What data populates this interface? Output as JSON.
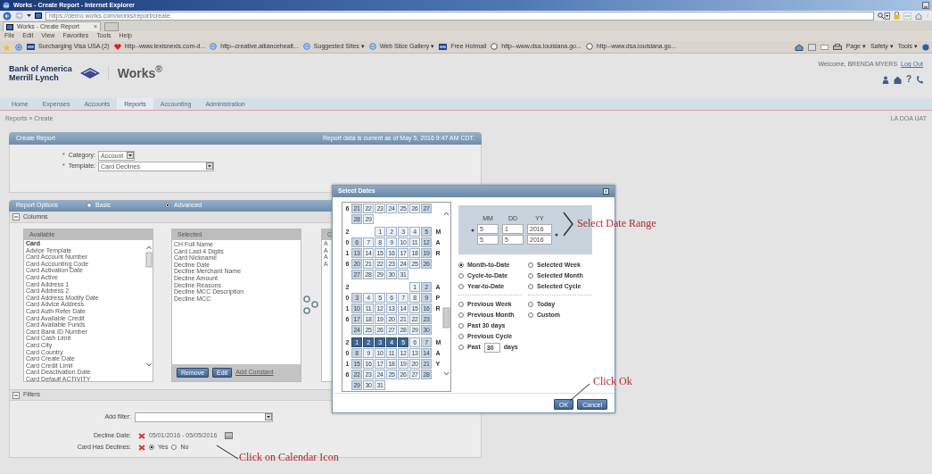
{
  "browser": {
    "title": "Works - Create Report - Internet Explorer",
    "address": "https://demo.works.com/works/report/create",
    "tab": "Works - Create Report",
    "tab_close": "×",
    "menu": [
      "File",
      "Edit",
      "View",
      "Favorites",
      "Tools",
      "Help"
    ],
    "favorites": [
      {
        "label": "Surcharging Visa USA (2)",
        "kind": "page"
      },
      {
        "label": "http--www.lexisnexis.com-d...",
        "kind": "heart"
      },
      {
        "label": "http--creative.alliancehealt...",
        "kind": "ie"
      },
      {
        "label": "Suggested Sites ▾",
        "kind": "ie"
      },
      {
        "label": "Web Slice Gallery ▾",
        "kind": "ie"
      },
      {
        "label": "Free Hotmail",
        "kind": "page"
      },
      {
        "label": "http--www.dsa.louisiana.go...",
        "kind": "globe"
      },
      {
        "label": "http--www.dsa.louisiana.go...",
        "kind": "globe"
      }
    ],
    "commands": [
      "Page ▾",
      "Safety ▾",
      "Tools ▾"
    ]
  },
  "app": {
    "logo_lines": [
      "Bank of America",
      "Merrill Lynch"
    ],
    "product": "Works$^{®}$",
    "welcome": "Welcome, BRENDA MYERS",
    "logout": "Log Out",
    "help_glyph": "?",
    "nav": [
      {
        "label": "Home",
        "selected": false
      },
      {
        "label": "Expenses",
        "selected": false
      },
      {
        "label": "Accounts",
        "selected": false
      },
      {
        "label": "Reports",
        "selected": true
      },
      {
        "label": "Accounting",
        "selected": false
      },
      {
        "label": "Administration",
        "selected": false
      }
    ],
    "breadcrumb": "Reports » Create",
    "environment": "LA DOA UAT"
  },
  "create_report": {
    "title": "Create Report",
    "data_note": "Report data is current as of May 5, 2016 9:47 AM CDT.",
    "fields": [
      {
        "marker": "*",
        "label": "Category:",
        "value": "Account"
      },
      {
        "marker": "*",
        "label": "Template:",
        "value": "Card Declines"
      }
    ]
  },
  "report_options": {
    "title": "Report Options",
    "modes": [
      {
        "label": "Basic",
        "selected": false
      },
      {
        "label": "Advanced",
        "selected": true
      }
    ],
    "columns": {
      "title": "Columns",
      "expanded": true,
      "available": {
        "heading": "Available",
        "items": [
          {
            "label": "Card",
            "kind": "group"
          },
          {
            "label": "Advice Template",
            "kind": "field"
          },
          {
            "label": "Card Account Number",
            "kind": "field"
          },
          {
            "label": "Card Accounting Code",
            "kind": "field"
          },
          {
            "label": "Card Activation Date",
            "kind": "field"
          },
          {
            "label": "Card Active",
            "kind": "field"
          },
          {
            "label": "Card Address 1",
            "kind": "field"
          },
          {
            "label": "Card Address 2",
            "kind": "field"
          },
          {
            "label": "Card Address Modify Date",
            "kind": "field"
          },
          {
            "label": "Card Advice Address",
            "kind": "field"
          },
          {
            "label": "Card Auth Refer Date",
            "kind": "field"
          },
          {
            "label": "Card Available Credit",
            "kind": "field"
          },
          {
            "label": "Card Available Funds",
            "kind": "field"
          },
          {
            "label": "Card Bank ID Number",
            "kind": "field"
          },
          {
            "label": "Card Cash Limit",
            "kind": "field"
          },
          {
            "label": "Card City",
            "kind": "field"
          },
          {
            "label": "Card Country",
            "kind": "field"
          },
          {
            "label": "Card Create Date",
            "kind": "field"
          },
          {
            "label": "Card Credit Limit",
            "kind": "field"
          },
          {
            "label": "Card Deactivation Date",
            "kind": "field"
          },
          {
            "label": "Card Default ACTIVITY",
            "kind": "field"
          }
        ]
      },
      "selected": {
        "heading": "Selected",
        "items": [
          "CH Full Name",
          "Card Last 4 Digits",
          "Card Nickname",
          "Decline Date",
          "Decline Merchant Name",
          "Decline Amount",
          "Decline Reasons",
          "Decline MCC Description",
          "Decline MCC"
        ],
        "buttons": [
          "Remove",
          "Edit"
        ],
        "link": "Add Constant"
      },
      "third": {
        "heading": "C",
        "items": [
          "A",
          "A",
          "A",
          "A"
        ]
      }
    },
    "filters": {
      "title": "Filters",
      "expanded": true,
      "add_filter_label": "Add filter:",
      "rows": [
        {
          "label": "Decline Date:",
          "kind": "date-range",
          "value": "05/01/2016 - 05/05/2016"
        },
        {
          "label": "Card Has Declines:",
          "kind": "yes-no",
          "options": [
            {
              "label": "Yes",
              "selected": true
            },
            {
              "label": "No",
              "selected": false
            }
          ]
        }
      ]
    }
  },
  "dialog": {
    "title": "Select Dates",
    "months": [
      {
        "year": "6",
        "weeks": [
          [
            {
              "kind": "day",
              "day": "21",
              "selected": false
            },
            {
              "kind": "day",
              "day": "22",
              "selected": false
            },
            {
              "kind": "day",
              "day": "23",
              "selected": false
            },
            {
              "kind": "day",
              "day": "24",
              "selected": false
            },
            {
              "kind": "day",
              "day": "25",
              "selected": false
            },
            {
              "kind": "day",
              "day": "26",
              "selected": false
            },
            {
              "kind": "day",
              "day": "27",
              "selected": false
            }
          ],
          [
            {
              "kind": "day",
              "day": "28",
              "selected": false
            },
            {
              "kind": "day",
              "day": "29",
              "selected": false
            },
            {
              "kind": "empty"
            },
            {
              "kind": "empty"
            },
            {
              "kind": "empty"
            },
            {
              "kind": "empty"
            },
            {
              "kind": "empty"
            }
          ]
        ]
      },
      {
        "year": "2016",
        "month": "MAR",
        "weeks": [
          [
            {
              "kind": "empty"
            },
            {
              "kind": "empty"
            },
            {
              "kind": "day",
              "day": "1",
              "selected": false
            },
            {
              "kind": "day",
              "day": "2",
              "selected": false
            },
            {
              "kind": "day",
              "day": "3",
              "selected": false
            },
            {
              "kind": "day",
              "day": "4",
              "selected": false
            },
            {
              "kind": "day",
              "day": "5",
              "selected": false
            }
          ],
          [
            {
              "kind": "day",
              "day": "6",
              "selected": false
            },
            {
              "kind": "day",
              "day": "7",
              "selected": false
            },
            {
              "kind": "day",
              "day": "8",
              "selected": false
            },
            {
              "kind": "day",
              "day": "9",
              "selected": false
            },
            {
              "kind": "day",
              "day": "10",
              "selected": false
            },
            {
              "kind": "day",
              "day": "11",
              "selected": false
            },
            {
              "kind": "day",
              "day": "12",
              "selected": false
            }
          ],
          [
            {
              "kind": "day",
              "day": "13",
              "selected": false
            },
            {
              "kind": "day",
              "day": "14",
              "selected": false
            },
            {
              "kind": "day",
              "day": "15",
              "selected": false
            },
            {
              "kind": "day",
              "day": "16",
              "selected": false
            },
            {
              "kind": "day",
              "day": "17",
              "selected": false
            },
            {
              "kind": "day",
              "day": "18",
              "selected": false
            },
            {
              "kind": "day",
              "day": "19",
              "selected": false
            }
          ],
          [
            {
              "kind": "day",
              "day": "20",
              "selected": false
            },
            {
              "kind": "day",
              "day": "21",
              "selected": false
            },
            {
              "kind": "day",
              "day": "22",
              "selected": false
            },
            {
              "kind": "day",
              "day": "23",
              "selected": false
            },
            {
              "kind": "day",
              "day": "24",
              "selected": false
            },
            {
              "kind": "day",
              "day": "25",
              "selected": false
            },
            {
              "kind": "day",
              "day": "26",
              "selected": false
            }
          ],
          [
            {
              "kind": "day",
              "day": "27",
              "selected": false
            },
            {
              "kind": "day",
              "day": "28",
              "selected": false
            },
            {
              "kind": "day",
              "day": "29",
              "selected": false
            },
            {
              "kind": "day",
              "day": "30",
              "selected": false
            },
            {
              "kind": "day",
              "day": "31",
              "selected": false
            },
            {
              "kind": "empty"
            },
            {
              "kind": "empty"
            }
          ]
        ]
      },
      {
        "year": "2016",
        "month": "APR",
        "weeks": [
          [
            {
              "kind": "empty"
            },
            {
              "kind": "empty"
            },
            {
              "kind": "empty"
            },
            {
              "kind": "empty"
            },
            {
              "kind": "empty"
            },
            {
              "kind": "day",
              "day": "1",
              "selected": false
            },
            {
              "kind": "day",
              "day": "2",
              "selected": false
            }
          ],
          [
            {
              "kind": "day",
              "day": "3",
              "selected": false
            },
            {
              "kind": "day",
              "day": "4",
              "selected": false
            },
            {
              "kind": "day",
              "day": "5",
              "selected": false
            },
            {
              "kind": "day",
              "day": "6",
              "selected": false
            },
            {
              "kind": "day",
              "day": "7",
              "selected": false
            },
            {
              "kind": "day",
              "day": "8",
              "selected": false
            },
            {
              "kind": "day",
              "day": "9",
              "selected": false
            }
          ],
          [
            {
              "kind": "day",
              "day": "10",
              "selected": false
            },
            {
              "kind": "day",
              "day": "11",
              "selected": false
            },
            {
              "kind": "day",
              "day": "12",
              "selected": false
            },
            {
              "kind": "day",
              "day": "13",
              "selected": false
            },
            {
              "kind": "day",
              "day": "14",
              "selected": false
            },
            {
              "kind": "day",
              "day": "15",
              "selected": false
            },
            {
              "kind": "day",
              "day": "16",
              "selected": false
            }
          ],
          [
            {
              "kind": "day",
              "day": "17",
              "selected": false
            },
            {
              "kind": "day",
              "day": "18",
              "selected": false
            },
            {
              "kind": "day",
              "day": "19",
              "selected": false
            },
            {
              "kind": "day",
              "day": "20",
              "selected": false
            },
            {
              "kind": "day",
              "day": "21",
              "selected": false
            },
            {
              "kind": "day",
              "day": "22",
              "selected": false
            },
            {
              "kind": "day",
              "day": "23",
              "selected": false
            }
          ],
          [
            {
              "kind": "day",
              "day": "24",
              "selected": false
            },
            {
              "kind": "day",
              "day": "25",
              "selected": false
            },
            {
              "kind": "day",
              "day": "26",
              "selected": false
            },
            {
              "kind": "day",
              "day": "27",
              "selected": false
            },
            {
              "kind": "day",
              "day": "28",
              "selected": false
            },
            {
              "kind": "day",
              "day": "29",
              "selected": false
            },
            {
              "kind": "day",
              "day": "30",
              "selected": false
            }
          ]
        ]
      },
      {
        "year": "2016",
        "month": "MAY",
        "weeks": [
          [
            {
              "kind": "day",
              "day": "1",
              "selected": true
            },
            {
              "kind": "day",
              "day": "2",
              "selected": true
            },
            {
              "kind": "day",
              "day": "3",
              "selected": true
            },
            {
              "kind": "day",
              "day": "4",
              "selected": true
            },
            {
              "kind": "day",
              "day": "5",
              "selected": true
            },
            {
              "kind": "day",
              "day": "6",
              "selected": false
            },
            {
              "kind": "day",
              "day": "7",
              "selected": false
            }
          ],
          [
            {
              "kind": "day",
              "day": "8",
              "selected": false
            },
            {
              "kind": "day",
              "day": "9",
              "selected": false
            },
            {
              "kind": "day",
              "day": "10",
              "selected": false
            },
            {
              "kind": "day",
              "day": "11",
              "selected": false
            },
            {
              "kind": "day",
              "day": "12",
              "selected": false
            },
            {
              "kind": "day",
              "day": "13",
              "selected": false
            },
            {
              "kind": "day",
              "day": "14",
              "selected": false
            }
          ],
          [
            {
              "kind": "day",
              "day": "15",
              "selected": false
            },
            {
              "kind": "day",
              "day": "16",
              "selected": false
            },
            {
              "kind": "day",
              "day": "17",
              "selected": false
            },
            {
              "kind": "day",
              "day": "18",
              "selected": false
            },
            {
              "kind": "day",
              "day": "19",
              "selected": false
            },
            {
              "kind": "day",
              "day": "20",
              "selected": false
            },
            {
              "kind": "day",
              "day": "21",
              "selected": false
            }
          ],
          [
            {
              "kind": "day",
              "day": "22",
              "selected": false
            },
            {
              "kind": "day",
              "day": "23",
              "selected": false
            },
            {
              "kind": "day",
              "day": "24",
              "selected": false
            },
            {
              "kind": "day",
              "day": "25",
              "selected": false
            },
            {
              "kind": "day",
              "day": "26",
              "selected": false
            },
            {
              "kind": "day",
              "day": "27",
              "selected": false
            },
            {
              "kind": "day",
              "day": "28",
              "selected": false
            }
          ],
          [
            {
              "kind": "day",
              "day": "29",
              "selected": false
            },
            {
              "kind": "day",
              "day": "30",
              "selected": false
            },
            {
              "kind": "day",
              "day": "31",
              "selected": false
            },
            {
              "kind": "empty"
            },
            {
              "kind": "empty"
            },
            {
              "kind": "empty"
            },
            {
              "kind": "empty"
            }
          ]
        ]
      }
    ],
    "range": {
      "headers": [
        "MM",
        "DD",
        "YY"
      ],
      "rows": [
        [
          "5",
          "1",
          "2016"
        ],
        [
          "5",
          "5",
          "2016"
        ]
      ]
    },
    "preset_columns": [
      [
        [
          {
            "label": "Month-to-Date",
            "selected": true,
            "kind": "plain"
          },
          {
            "label": "Cycle-to-Date",
            "selected": false,
            "kind": "plain"
          },
          {
            "label": "Year-to-Date",
            "selected": false,
            "kind": "plain"
          }
        ],
        [
          {
            "label": "Previous Week",
            "selected": false,
            "kind": "plain"
          },
          {
            "label": "Previous Month",
            "selected": false,
            "kind": "plain"
          },
          {
            "label": "Past 30 days",
            "selected": false,
            "kind": "plain"
          },
          {
            "label": "Previous Cycle",
            "selected": false,
            "kind": "plain"
          },
          {
            "label": "Past",
            "value": "30",
            "suffix": "days",
            "selected": false,
            "kind": "input"
          }
        ]
      ],
      [
        [
          {
            "label": "Selected Week",
            "selected": false,
            "kind": "plain"
          },
          {
            "label": "Selected Month",
            "selected": false,
            "kind": "plain"
          },
          {
            "label": "Selected Cycle",
            "selected": false,
            "kind": "plain"
          }
        ],
        [
          {
            "label": "Today",
            "selected": false,
            "kind": "plain"
          },
          {
            "label": "Custom",
            "selected": false,
            "kind": "plain"
          }
        ]
      ]
    ],
    "buttons": [
      "OK",
      "Cancel"
    ]
  },
  "annotations": [
    {
      "text": "Select Date Range",
      "kind": "chevron"
    },
    {
      "text": "Click Ok",
      "kind": "leader"
    },
    {
      "text": "Click on Calendar Icon",
      "kind": "leader"
    }
  ]
}
